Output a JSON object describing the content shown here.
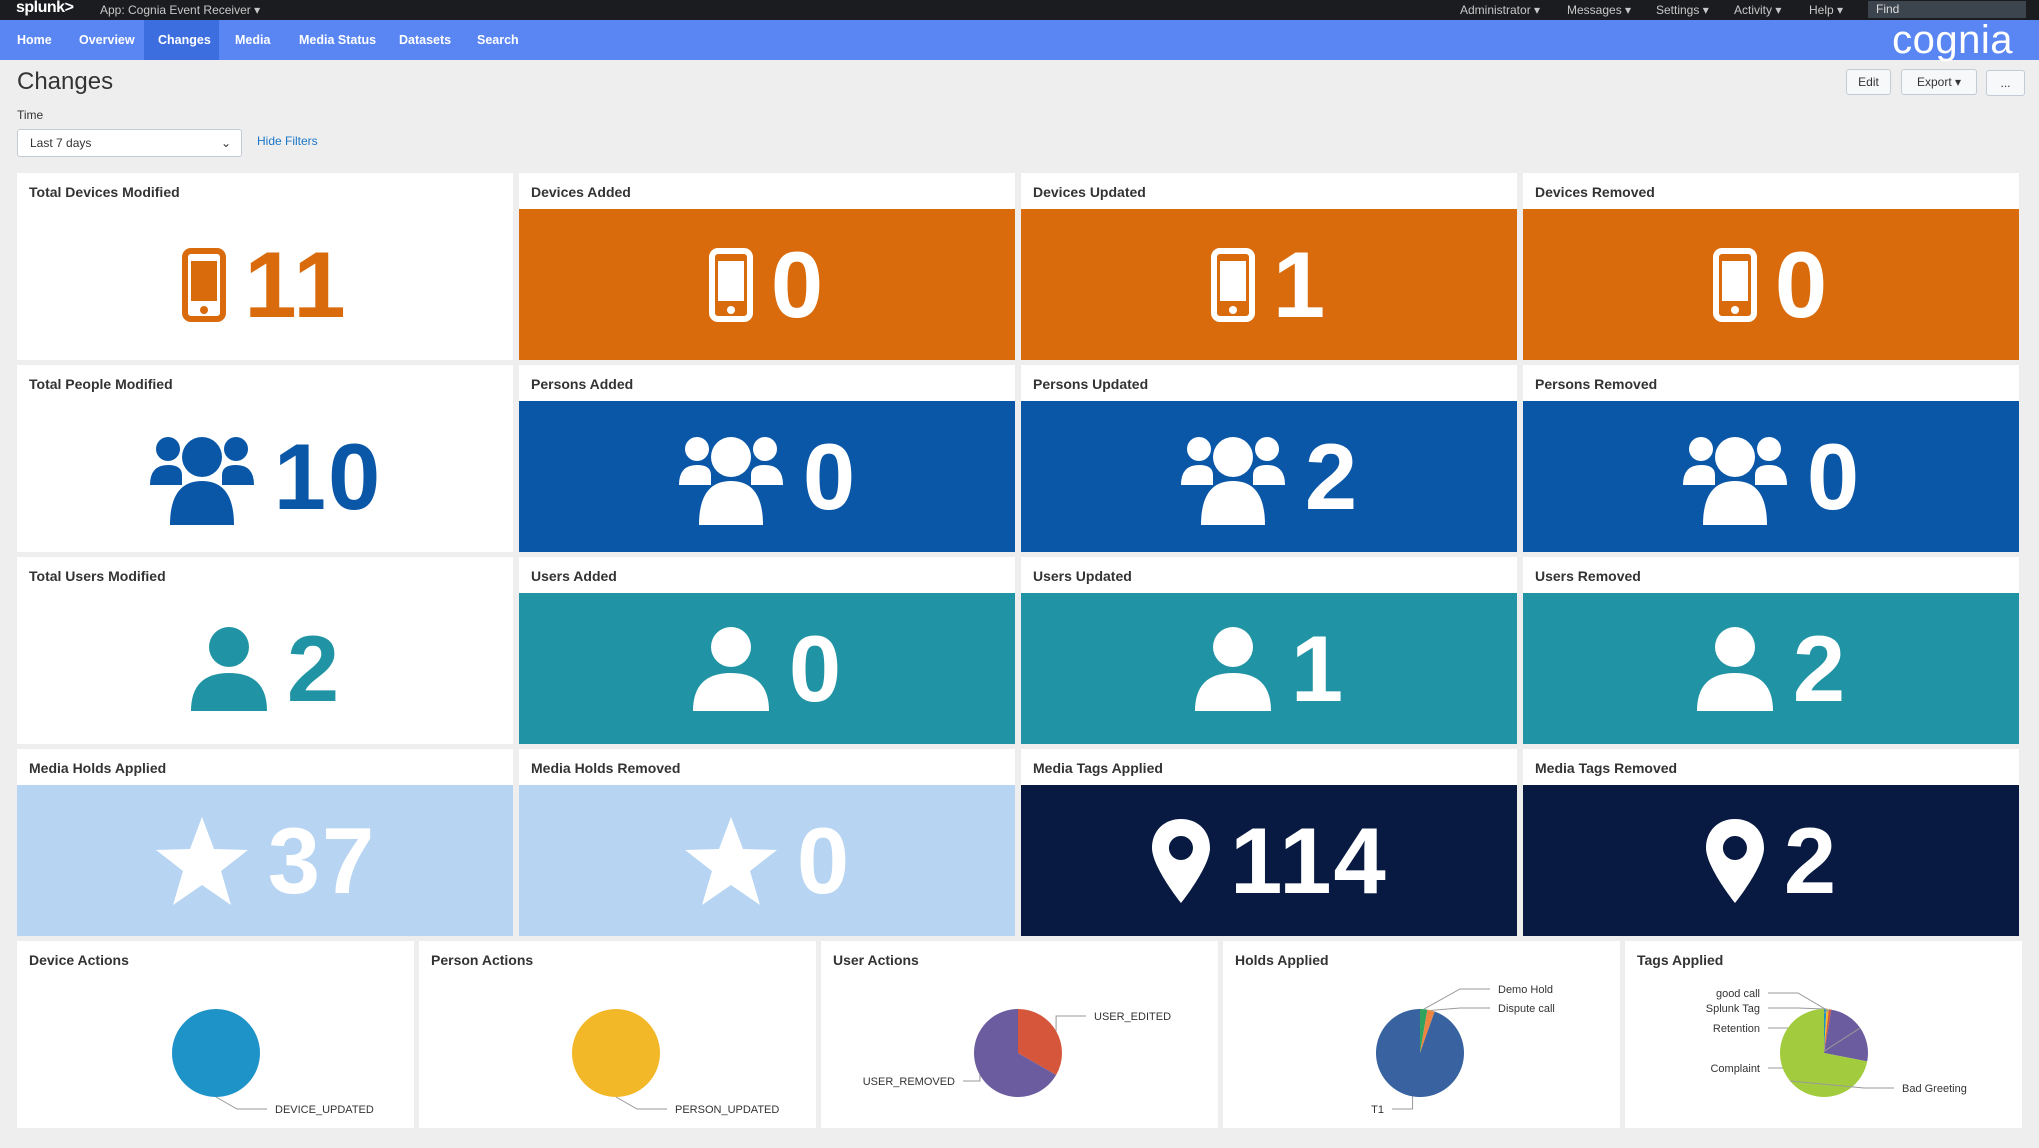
{
  "topbar": {
    "logo": "splunk>",
    "app": "App: Cognia Event Receiver ▾",
    "menus": [
      "Administrator ▾",
      "Messages ▾",
      "Settings ▾",
      "Activity ▾",
      "Help ▾"
    ],
    "find_placeholder": "Find"
  },
  "nav": {
    "items": [
      "Home",
      "Overview",
      "Changes",
      "Media",
      "Media Status",
      "Datasets",
      "Search"
    ],
    "active": "Changes",
    "brand": "cognia"
  },
  "page": {
    "title": "Changes",
    "edit_label": "Edit",
    "export_label": "Export ▾",
    "more_label": "...",
    "time_label": "Time",
    "time_value": "Last 7 days",
    "hide_filters": "Hide Filters"
  },
  "colors": {
    "orange": "#d96b0c",
    "blue": "#0a57a8",
    "teal": "#2094a4",
    "lightblue": "#b7d5f2",
    "navy": "#081a42"
  },
  "panels": [
    {
      "title": "Total Devices Modified",
      "value": "11",
      "icon": "phone-icon",
      "bg": "#ffffff",
      "fg": "#d96b0c"
    },
    {
      "title": "Devices Added",
      "value": "0",
      "icon": "phone-icon",
      "bg": "#d96b0c",
      "fg": "#ffffff"
    },
    {
      "title": "Devices Updated",
      "value": "1",
      "icon": "phone-icon",
      "bg": "#d96b0c",
      "fg": "#ffffff"
    },
    {
      "title": "Devices Removed",
      "value": "0",
      "icon": "phone-icon",
      "bg": "#d96b0c",
      "fg": "#ffffff"
    },
    {
      "title": "Total People Modified",
      "value": "10",
      "icon": "group-icon",
      "bg": "#ffffff",
      "fg": "#0a57a8"
    },
    {
      "title": "Persons Added",
      "value": "0",
      "icon": "group-icon",
      "bg": "#0a57a8",
      "fg": "#ffffff"
    },
    {
      "title": "Persons Updated",
      "value": "2",
      "icon": "group-icon",
      "bg": "#0a57a8",
      "fg": "#ffffff"
    },
    {
      "title": "Persons Removed",
      "value": "0",
      "icon": "group-icon",
      "bg": "#0a57a8",
      "fg": "#ffffff"
    },
    {
      "title": "Total Users Modified",
      "value": "2",
      "icon": "user-icon",
      "bg": "#ffffff",
      "fg": "#2094a4"
    },
    {
      "title": "Users Added",
      "value": "0",
      "icon": "user-icon",
      "bg": "#2094a4",
      "fg": "#ffffff"
    },
    {
      "title": "Users Updated",
      "value": "1",
      "icon": "user-icon",
      "bg": "#2094a4",
      "fg": "#ffffff"
    },
    {
      "title": "Users Removed",
      "value": "2",
      "icon": "user-icon",
      "bg": "#2094a4",
      "fg": "#ffffff"
    },
    {
      "title": "Media Holds Applied",
      "value": "37",
      "icon": "star-icon",
      "bg": "#b7d5f2",
      "fg": "#ffffff"
    },
    {
      "title": "Media Holds Removed",
      "value": "0",
      "icon": "star-icon",
      "bg": "#b7d5f2",
      "fg": "#ffffff"
    },
    {
      "title": "Media Tags Applied",
      "value": "114",
      "icon": "map-pin-icon",
      "bg": "#081a42",
      "fg": "#ffffff"
    },
    {
      "title": "Media Tags Removed",
      "value": "2",
      "icon": "map-pin-icon",
      "bg": "#081a42",
      "fg": "#ffffff"
    }
  ],
  "chart_data": [
    {
      "type": "pie",
      "title": "Device Actions",
      "slices": [
        {
          "label": "DEVICE_UPDATED",
          "value": 1,
          "color": "#1e93c8"
        }
      ]
    },
    {
      "type": "pie",
      "title": "Person Actions",
      "slices": [
        {
          "label": "PERSON_UPDATED",
          "value": 2,
          "color": "#f2b827"
        }
      ]
    },
    {
      "type": "pie",
      "title": "User Actions",
      "slices": [
        {
          "label": "USER_EDITED",
          "value": 1,
          "color": "#d6563c"
        },
        {
          "label": "USER_REMOVED",
          "value": 2,
          "color": "#6a5c9e"
        }
      ]
    },
    {
      "type": "pie",
      "title": "Holds Applied",
      "slices": [
        {
          "label": "Demo Hold",
          "value": 1,
          "color": "#31a35f"
        },
        {
          "label": "Dispute call",
          "value": 1,
          "color": "#ed8440"
        },
        {
          "label": "T1",
          "value": 35,
          "color": "#3863a0"
        }
      ]
    },
    {
      "type": "pie",
      "title": "Tags Applied",
      "slices": [
        {
          "label": "good call",
          "value": 1,
          "color": "#1e93c8"
        },
        {
          "label": "Splunk Tag",
          "value": 1,
          "color": "#f2b827"
        },
        {
          "label": "Retention",
          "value": 1,
          "color": "#d6563c"
        },
        {
          "label": "Complaint",
          "value": 29,
          "color": "#6a5c9e"
        },
        {
          "label": "Bad Greeting",
          "value": 82,
          "color": "#a2cc3e"
        }
      ]
    }
  ]
}
